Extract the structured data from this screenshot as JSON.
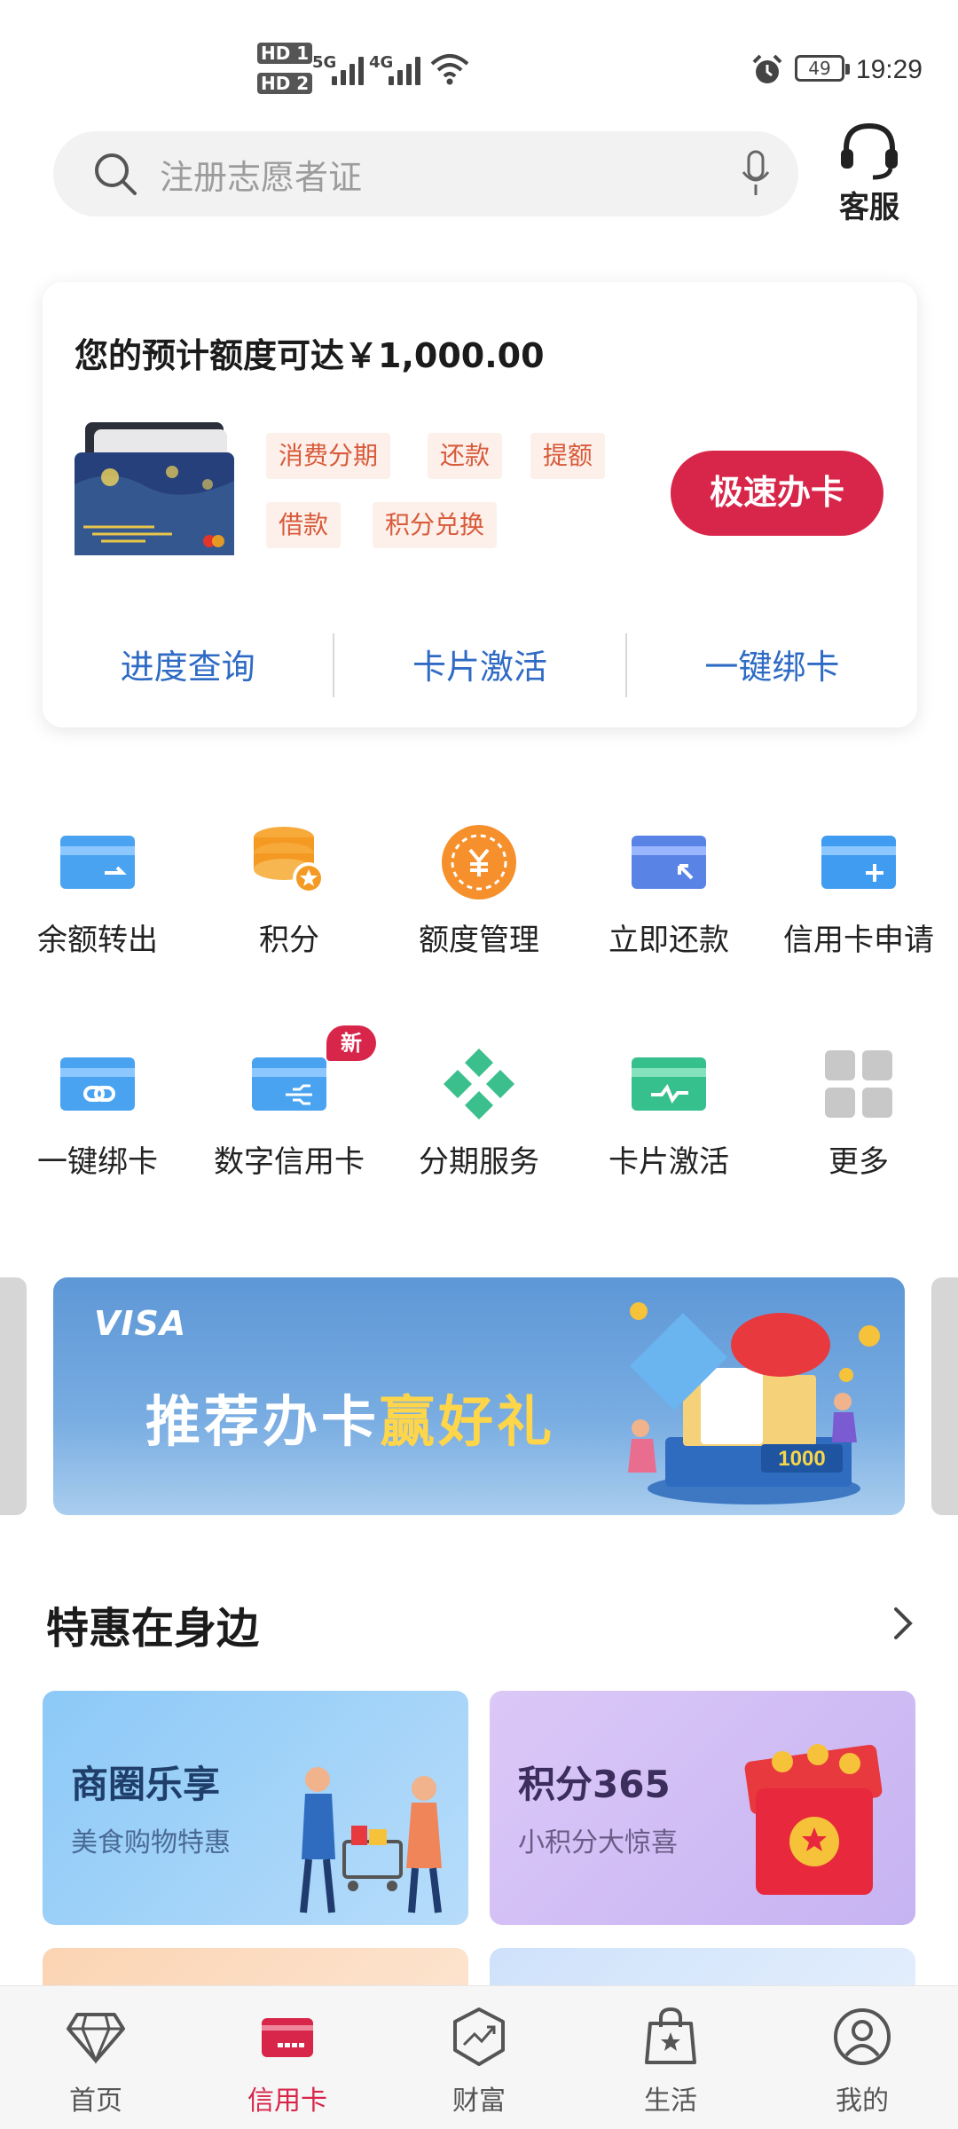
{
  "status_bar": {
    "sim1": "HD 1",
    "sim2": "HD 2",
    "net1": "5G",
    "net2": "4G",
    "battery": "49",
    "time": "19:29"
  },
  "search": {
    "placeholder": "注册志愿者证",
    "customer_service": "客服"
  },
  "credit_panel": {
    "quota_text": "您的预计额度可达￥1,000.00",
    "tags": [
      "消费分期",
      "还款",
      "提额",
      "借款",
      "积分兑换"
    ],
    "apply_button": "极速办卡",
    "links": [
      "进度查询",
      "卡片激活",
      "一键绑卡"
    ]
  },
  "services": [
    {
      "label": "余额转出",
      "icon": "card-transfer-icon"
    },
    {
      "label": "积分",
      "icon": "points-coins-icon"
    },
    {
      "label": "额度管理",
      "icon": "yuan-coin-icon"
    },
    {
      "label": "立即还款",
      "icon": "card-repay-icon"
    },
    {
      "label": "信用卡申请",
      "icon": "card-add-icon"
    },
    {
      "label": "一键绑卡",
      "icon": "card-link-icon"
    },
    {
      "label": "数字信用卡",
      "icon": "digital-card-icon"
    },
    {
      "label": "分期服务",
      "icon": "installment-diamond-icon"
    },
    {
      "label": "卡片激活",
      "icon": "card-activate-icon"
    },
    {
      "label": "更多",
      "icon": "more-grid-icon"
    }
  ],
  "new_badge": "新",
  "banner": {
    "brand": "VISA",
    "title_main": "推荐办卡",
    "title_highlight": "赢好礼",
    "amount": "1000"
  },
  "section": {
    "title": "特惠在身边"
  },
  "promos": [
    {
      "title": "商圈乐享",
      "subtitle": "美食购物特惠"
    },
    {
      "title": "积分365",
      "subtitle": "小积分大惊喜"
    }
  ],
  "bottom_nav": [
    {
      "label": "首页",
      "icon": "diamond-icon"
    },
    {
      "label": "信用卡",
      "icon": "credit-card-icon"
    },
    {
      "label": "财富",
      "icon": "wealth-chart-icon"
    },
    {
      "label": "生活",
      "icon": "shopping-bag-icon"
    },
    {
      "label": "我的",
      "icon": "user-icon"
    }
  ],
  "colors": {
    "accent": "#d8264a",
    "link_blue": "#2f6bc4",
    "tag_text": "#d85a3a"
  }
}
